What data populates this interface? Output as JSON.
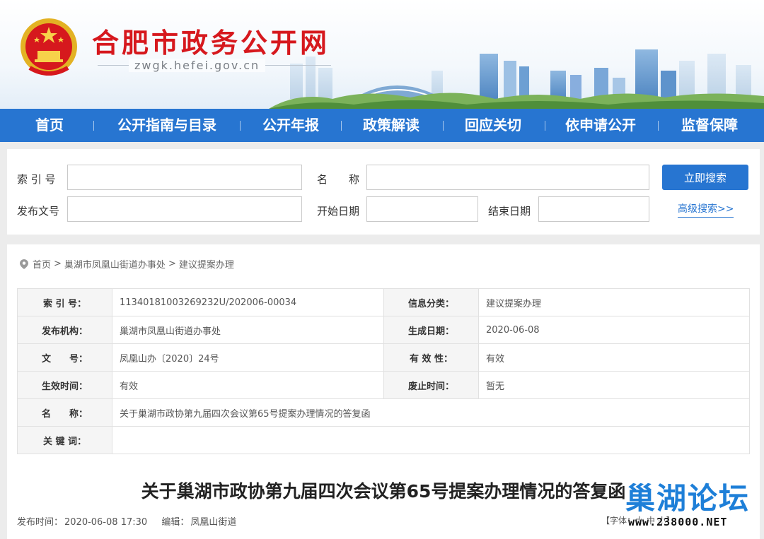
{
  "header": {
    "site_title": "合肥市政务公开网",
    "domain": "zwgk.hefei.gov.cn",
    "emblem_icon": "national-emblem-icon"
  },
  "nav": {
    "items": [
      "首页",
      "公开指南与目录",
      "公开年报",
      "政策解读",
      "回应关切",
      "依申请公开",
      "监督保障"
    ]
  },
  "search": {
    "index_label": "索 引 号",
    "name_label": "名　　称",
    "doc_no_label": "发布文号",
    "start_label": "开始日期",
    "end_label": "结束日期",
    "search_button": "立即搜索",
    "advanced_link": "高级搜索>>"
  },
  "breadcrumb": {
    "home": "首页",
    "sep": ">",
    "level1": "巢湖市凤凰山街道办事处",
    "level2": "建议提案办理"
  },
  "meta": {
    "index_no_label": "索 引 号：",
    "index_no": "11340181003269232U/202006-00034",
    "category_label": "信息分类：",
    "category": "建议提案办理",
    "publisher_label": "发布机构：",
    "publisher": "巢湖市凤凰山街道办事处",
    "created_label": "生成日期：",
    "created": "2020-06-08",
    "doc_no_label": "文　　号：",
    "doc_no": "凤凰山办〔2020〕24号",
    "validity_label": "有 效 性：",
    "validity": "有效",
    "effective_label": "生效时间：",
    "effective": "有效",
    "abolish_label": "废止时间：",
    "abolish": "暂无",
    "name_label": "名　　称：",
    "name": "关于巢湖市政协第九届四次会议第65号提案办理情况的答复函",
    "keywords_label": "关 键 词：",
    "keywords": ""
  },
  "article": {
    "title": "关于巢湖市政协第九届四次会议第65号提案办理情况的答复函",
    "pub_time_label": "发布时间：",
    "pub_time": "2020-06-08 17:30",
    "editor_label": "编辑：",
    "editor": "凤凰山街道",
    "font_ctrl": "【字体：大 中 小】"
  },
  "watermark": {
    "text": "巢湖论坛",
    "url": "www.238000.NET"
  },
  "colors": {
    "nav_blue": "#2775d1",
    "title_red": "#d6181d",
    "watermark_blue": "#1e7fd8"
  }
}
